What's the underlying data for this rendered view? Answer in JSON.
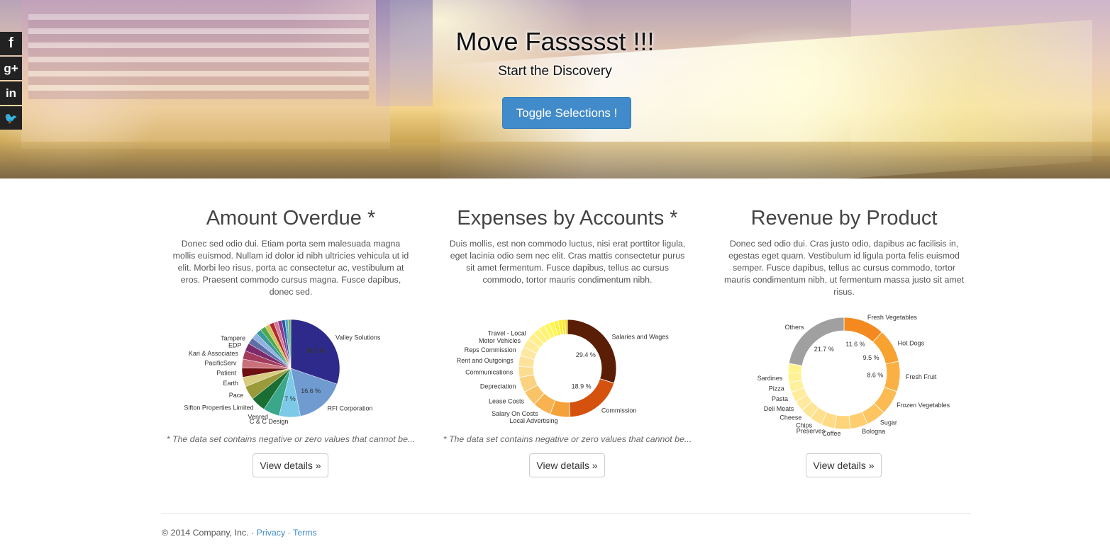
{
  "hero": {
    "title": "Move Fassssst !!!",
    "subtitle": "Start the Discovery",
    "button_label": "Toggle Selections !"
  },
  "social": [
    {
      "icon": "facebook-icon",
      "glyph": "f"
    },
    {
      "icon": "google-plus-icon",
      "glyph": "g+"
    },
    {
      "icon": "linkedin-icon",
      "glyph": "in"
    },
    {
      "icon": "twitter-icon",
      "glyph": "🐦"
    }
  ],
  "columns": [
    {
      "title": "Amount Overdue *",
      "text": "Donec sed odio dui. Etiam porta sem malesuada magna mollis euismod. Nullam id dolor id nibh ultricies vehicula ut id elit. Morbi leo risus, porta ac consectetur ac, vestibulum at eros. Praesent commodo cursus magna. Fusce dapibus, donec sed.",
      "note": "* The data set contains negative or zero values that cannot be...",
      "button": "View details »"
    },
    {
      "title": "Expenses by Accounts *",
      "text": "Duis mollis, est non commodo luctus, nisi erat porttitor ligula, eget lacinia odio sem nec elit. Cras mattis consectetur purus sit amet fermentum. Fusce dapibus, tellus ac cursus commodo, tortor mauris condimentum nibh.",
      "note": "* The data set contains negative or zero values that cannot be...",
      "button": "View details »"
    },
    {
      "title": "Revenue by Product",
      "text": "Donec sed odio dui. Cras justo odio, dapibus ac facilisis in, egestas eget quam. Vestibulum id ligula porta felis euismod semper. Fusce dapibus, tellus ac cursus commodo, tortor mauris condimentum nibh, ut fermentum massa justo sit amet risus.",
      "note": "",
      "button": "View details »"
    }
  ],
  "chart_data": [
    {
      "type": "pie",
      "slices": [
        {
          "label": "Valley Solutions",
          "value": 30.2,
          "pct_label": "30.2 %",
          "color": "#2e2a8c"
        },
        {
          "label": "RFI Corporation",
          "value": 16.6,
          "pct_label": "16.6 %",
          "color": "#6f9bd1"
        },
        {
          "label": "C & C Design",
          "value": 7.0,
          "pct_label": "7 %",
          "color": "#7cc9e8"
        },
        {
          "label": "Venred",
          "value": 5.4,
          "pct_label": "",
          "color": "#3aa68a"
        },
        {
          "label": "Sifton Properties Limited",
          "value": 5.0,
          "pct_label": "",
          "color": "#1a6e33"
        },
        {
          "label": "Pace",
          "value": 4.6,
          "pct_label": "",
          "color": "#9a9a3a"
        },
        {
          "label": "Earth",
          "value": 3.2,
          "pct_label": "",
          "color": "#d8cc80"
        },
        {
          "label": "Patient",
          "value": 3.0,
          "pct_label": "",
          "color": "#6e1010"
        },
        {
          "label": "PacificServ",
          "value": 3.0,
          "pct_label": "",
          "color": "#c9707a"
        },
        {
          "label": "Kari & Associates",
          "value": 2.8,
          "pct_label": "",
          "color": "#a33c5c"
        },
        {
          "label": "EDP",
          "value": 2.6,
          "pct_label": "",
          "color": "#7d2a6b"
        },
        {
          "label": "Tampere",
          "value": 2.2,
          "pct_label": "",
          "color": "#5e6fa8"
        },
        {
          "label": "",
          "value": 2.0,
          "pct_label": "",
          "color": "#8fb2e0"
        },
        {
          "label": "",
          "value": 1.8,
          "pct_label": "",
          "color": "#3a9a9a"
        },
        {
          "label": "",
          "value": 1.7,
          "pct_label": "",
          "color": "#4ea84e"
        },
        {
          "label": "",
          "value": 1.6,
          "pct_label": "",
          "color": "#cfc35a"
        },
        {
          "label": "",
          "value": 1.5,
          "pct_label": "",
          "color": "#b02a2a"
        },
        {
          "label": "",
          "value": 1.4,
          "pct_label": "",
          "color": "#d47a9a"
        },
        {
          "label": "",
          "value": 1.3,
          "pct_label": "",
          "color": "#8a3a8a"
        },
        {
          "label": "",
          "value": 1.1,
          "pct_label": "",
          "color": "#2a5aa8"
        },
        {
          "label": "",
          "value": 1.0,
          "pct_label": "",
          "color": "#5ab0c8"
        },
        {
          "label": "",
          "value": 0.9,
          "pct_label": "",
          "color": "#6ab06a"
        }
      ]
    },
    {
      "type": "pie",
      "donut": true,
      "slices": [
        {
          "label": "Salaries and Wages",
          "value": 29.4,
          "pct_label": "29.4 %",
          "color": "#5a1d05"
        },
        {
          "label": "Commission",
          "value": 18.9,
          "pct_label": "18.9 %",
          "color": "#d4520e"
        },
        {
          "label": "Local Advertising",
          "value": 6.5,
          "pct_label": "",
          "color": "#f4a237"
        },
        {
          "label": "Salary On Costs",
          "value": 6.0,
          "pct_label": "",
          "color": "#f8b24f"
        },
        {
          "label": "Lease Costs",
          "value": 5.0,
          "pct_label": "",
          "color": "#f9c468"
        },
        {
          "label": "Depreciation",
          "value": 5.0,
          "pct_label": "",
          "color": "#fbd280"
        },
        {
          "label": "Communications",
          "value": 3.5,
          "pct_label": "",
          "color": "#fcdc8f"
        },
        {
          "label": "Rent and Outgoings",
          "value": 3.5,
          "pct_label": "",
          "color": "#fde29a"
        },
        {
          "label": "Reps Commission",
          "value": 3.0,
          "pct_label": "",
          "color": "#fee7a0"
        },
        {
          "label": "Motor Vehicles",
          "value": 3.0,
          "pct_label": "",
          "color": "#feec9c"
        },
        {
          "label": "Travel - Local",
          "value": 2.5,
          "pct_label": "",
          "color": "#fff08c"
        },
        {
          "label": "",
          "value": 2.2,
          "pct_label": "",
          "color": "#fff27f"
        },
        {
          "label": "",
          "value": 2.0,
          "pct_label": "",
          "color": "#fff470"
        },
        {
          "label": "",
          "value": 1.8,
          "pct_label": "",
          "color": "#fff560"
        },
        {
          "label": "",
          "value": 1.6,
          "pct_label": "",
          "color": "#fff650"
        },
        {
          "label": "",
          "value": 1.4,
          "pct_label": "",
          "color": "#fff140"
        },
        {
          "label": "",
          "value": 1.2,
          "pct_label": "",
          "color": "#fdeb30"
        },
        {
          "label": "",
          "value": 1.0,
          "pct_label": "",
          "color": "#f9e420"
        },
        {
          "label": "",
          "value": 0.8,
          "pct_label": "",
          "color": "#f4dd10"
        }
      ]
    },
    {
      "type": "pie",
      "donut": true,
      "slices": [
        {
          "label": "Fresh Vegetables",
          "value": 11.6,
          "pct_label": "11.6 %",
          "color": "#f4891f"
        },
        {
          "label": "Hot Dogs",
          "value": 9.5,
          "pct_label": "9.5 %",
          "color": "#f8a232"
        },
        {
          "label": "Fresh Fruit",
          "value": 8.6,
          "pct_label": "8.6 %",
          "color": "#fab042"
        },
        {
          "label": "Frozen Vegetables",
          "value": 7.0,
          "pct_label": "",
          "color": "#fbbb52"
        },
        {
          "label": "Sugar",
          "value": 5.5,
          "pct_label": "",
          "color": "#fcc562"
        },
        {
          "label": "Bologna",
          "value": 5.0,
          "pct_label": "",
          "color": "#fdcd6e"
        },
        {
          "label": "Coffee",
          "value": 4.5,
          "pct_label": "",
          "color": "#fdd47a"
        },
        {
          "label": "Preserves",
          "value": 3.8,
          "pct_label": "",
          "color": "#fedb84"
        },
        {
          "label": "Chips",
          "value": 3.5,
          "pct_label": "",
          "color": "#fee08e"
        },
        {
          "label": "Cheese",
          "value": 3.2,
          "pct_label": "",
          "color": "#fee596"
        },
        {
          "label": "Deli Meats",
          "value": 3.0,
          "pct_label": "",
          "color": "#ffe99c"
        },
        {
          "label": "Pasta",
          "value": 2.9,
          "pct_label": "",
          "color": "#ffed9c"
        },
        {
          "label": "Pizza",
          "value": 2.8,
          "pct_label": "",
          "color": "#fff09a"
        },
        {
          "label": "Sardines",
          "value": 2.7,
          "pct_label": "",
          "color": "#fff296"
        },
        {
          "label": "",
          "value": 2.7,
          "pct_label": "",
          "color": "#fff490"
        },
        {
          "label": "Others",
          "value": 21.7,
          "pct_label": "21.7 %",
          "color": "#a0a0a0"
        }
      ]
    }
  ],
  "footer": {
    "copyright": "© 2014 Company, Inc. ·",
    "privacy": "Privacy",
    "sep": "·",
    "terms": "Terms"
  }
}
